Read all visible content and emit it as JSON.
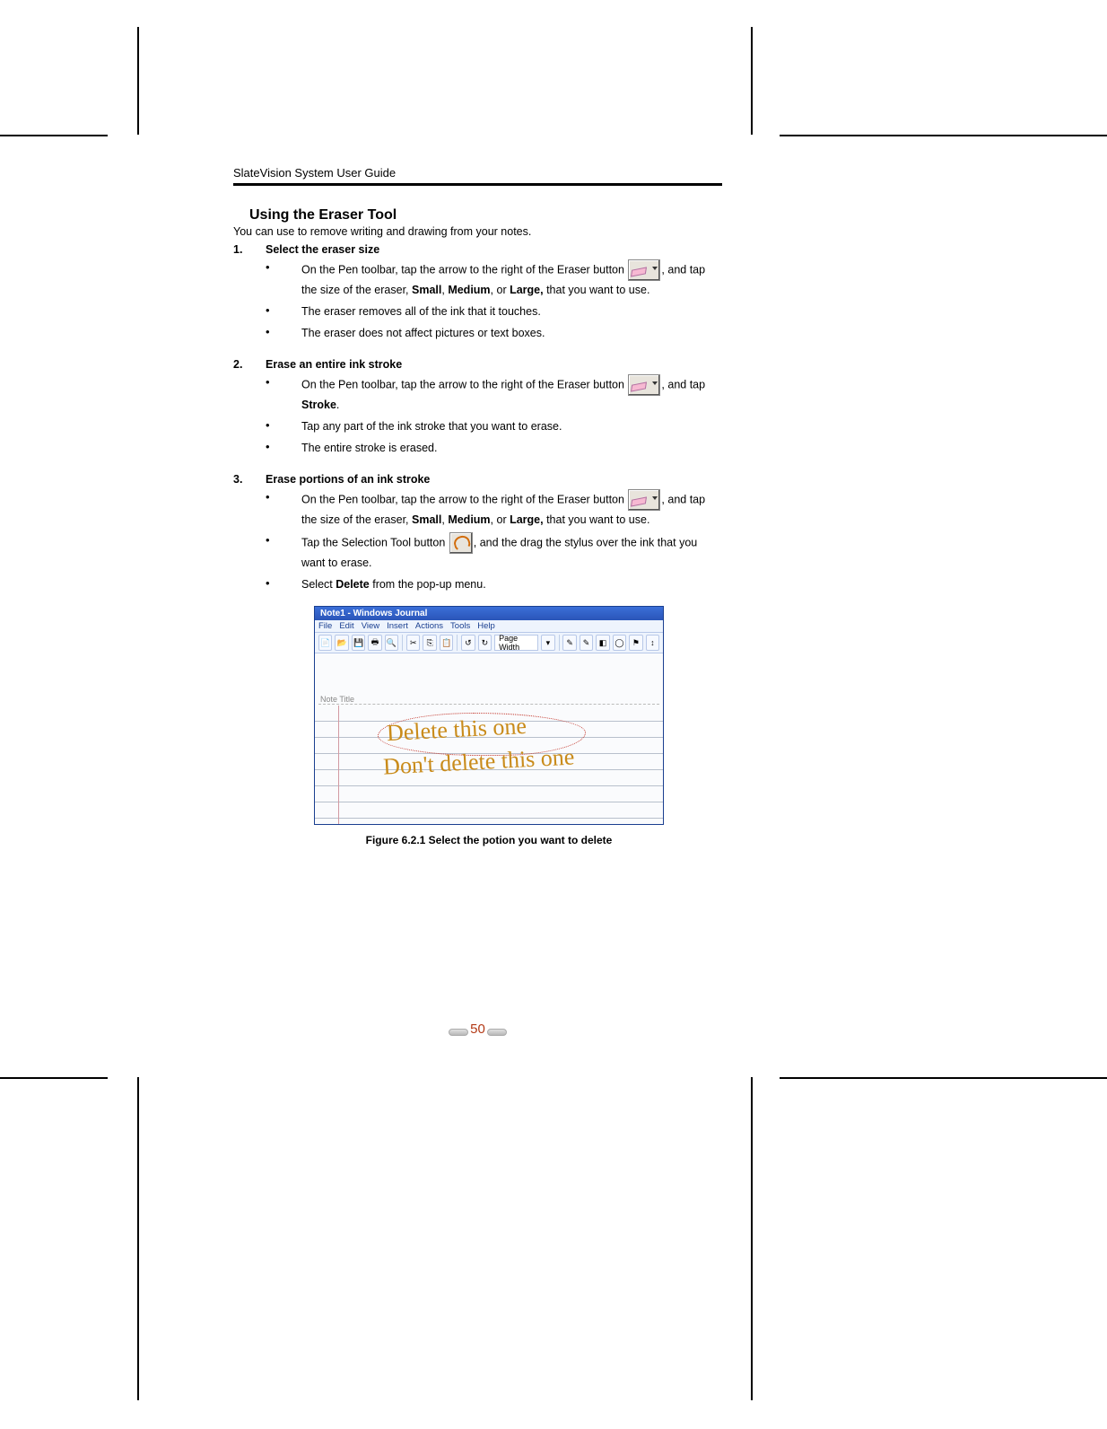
{
  "header": {
    "title": "SlateVision System User Guide"
  },
  "section_title": "Using the Eraser Tool",
  "intro": "You can use to remove writing and drawing from your notes.",
  "steps": [
    {
      "num": "1.",
      "title": "Select the eraser size",
      "bullets": [
        {
          "pre": "On the Pen toolbar, tap the arrow to the right of the Eraser button ",
          "icon": "eraser",
          "post_html": ", and tap the size of the eraser, <b>Small</b>, <b>Medium</b>, or <b>Large,</b> that you want to use."
        },
        {
          "plain": "The eraser removes all of the ink that it touches."
        },
        {
          "plain": "The eraser does not affect pictures or text boxes."
        }
      ]
    },
    {
      "num": "2.",
      "title": "Erase an entire ink stroke",
      "bullets": [
        {
          "pre": "On the Pen toolbar, tap the arrow to the right of the Eraser button ",
          "icon": "eraser",
          "post_html": ", and tap <b>Stroke</b>."
        },
        {
          "plain": "Tap any part of the ink stroke that you want to erase."
        },
        {
          "plain": "The entire stroke is erased."
        }
      ]
    },
    {
      "num": "3.",
      "title": "Erase portions of an ink stroke",
      "bullets": [
        {
          "pre": "On the Pen toolbar, tap the arrow to the right of the Eraser button ",
          "icon": "eraser",
          "post_html": ", and tap the size of the eraser, <b>Small</b>, <b>Medium</b>, or <b>Large,</b> that you want to use."
        },
        {
          "pre": "Tap the Selection Tool button ",
          "icon": "lasso",
          "post_html": ", and the drag the stylus over the ink that you want to erase."
        },
        {
          "post_html": "Select <b>Delete</b> from the pop-up menu."
        }
      ]
    }
  ],
  "journal": {
    "titlebar": "Note1 - Windows Journal",
    "menus": [
      "File",
      "Edit",
      "View",
      "Insert",
      "Actions",
      "Tools",
      "Help"
    ],
    "zoom_label": "Page Width",
    "note_title_label": "Note Title",
    "ink_line1": "Delete this one",
    "ink_line2": "Don't delete this one"
  },
  "figure_caption": "Figure 6.2.1 Select the potion you want to delete",
  "page_number": "50"
}
